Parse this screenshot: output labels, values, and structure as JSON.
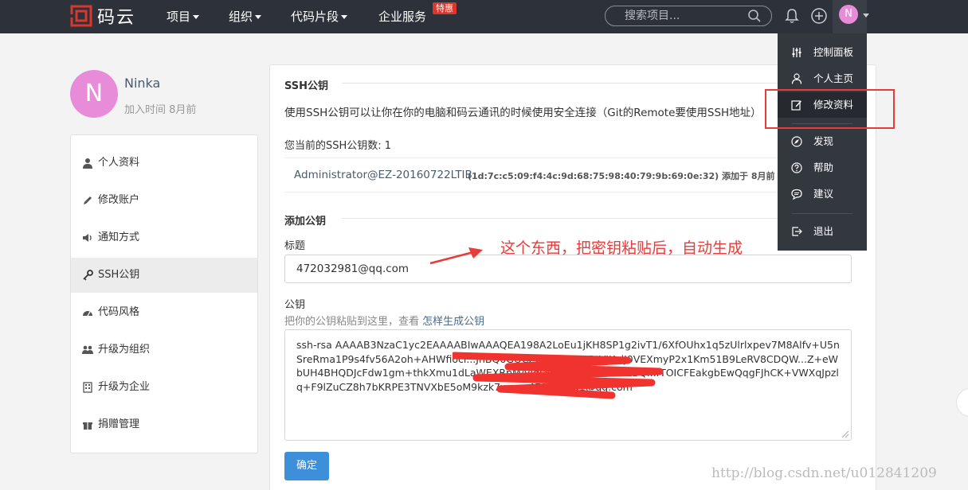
{
  "topbar": {
    "logo_text": "码云",
    "nav": [
      {
        "label": "项目",
        "has_caret": true
      },
      {
        "label": "组织",
        "has_caret": true
      },
      {
        "label": "代码片段",
        "has_caret": true
      },
      {
        "label": "企业服务",
        "has_caret": false
      }
    ],
    "badge": "特惠",
    "search_placeholder": "搜索项目...",
    "avatar_initial": "N"
  },
  "profile": {
    "avatar_initial": "N",
    "name": "Ninka",
    "joined": "加入时间 8月前"
  },
  "sidebar": {
    "items": [
      {
        "label": "个人资料",
        "icon": "user-icon"
      },
      {
        "label": "修改账户",
        "icon": "pencil-icon"
      },
      {
        "label": "通知方式",
        "icon": "speaker-icon"
      },
      {
        "label": "SSH公钥",
        "icon": "key-icon",
        "active": true
      },
      {
        "label": "代码风格",
        "icon": "dashboard-icon"
      },
      {
        "label": "升级为组织",
        "icon": "users-icon"
      },
      {
        "label": "升级为企业",
        "icon": "building-icon"
      },
      {
        "label": "捐赠管理",
        "icon": "gift-icon"
      }
    ]
  },
  "ssh": {
    "section_title": "SSH公钥",
    "description": "使用SSH公钥可以让你在你的电脑和码云通讯的时候使用安全连接（Git的Remote要使用SSH地址）",
    "count_text": "您当前的SSH公钥数: 1",
    "key": {
      "name": "Administrator@EZ-20160722LTIB",
      "fingerprint": "(1d:7c:c5:09:f4:4c:9d:68:75:98:40:79:9b:69:0e:32) 添加于 8月前"
    }
  },
  "add": {
    "section_title": "添加公钥",
    "title_label": "标题",
    "title_value": "472032981@qq.com",
    "key_label": "公钥",
    "hint": "把你的公钥粘贴到这里，查看",
    "hint_link": "怎样生成公钥",
    "key_value": "ssh-rsa AAAAB3NzaC1yc2EAAAABIwAAAQEA198A2LoEu1jKH8SP1g2ivT1/6XfOUhx1q5zUlrlxpev7M8Alfv+U5nSreRma1P9s4fv56A2oh+AHWfiocl...JnBQ6GOCZbwV+I2CRRtVJKulJ0VEXmyP2x1Km51B9LeRV8CDQW...Z+eWbUH4BHQDJcFdw1gm+thkXmu1dLaWEXRpM/yJqDQOyxH+Z9BNNZBQ...fTOICFEakgbEwQqgFJhCK+VWXqJpzlq+F9lZuCZ8h7bKRPE3TNVXbE5oM9kzk7w== 472032981@qq.com",
    "submit": "确定"
  },
  "dropdown": {
    "items": [
      {
        "label": "控制面板",
        "icon": "sliders-icon"
      },
      {
        "label": "个人主页",
        "icon": "person-icon"
      },
      {
        "label": "修改资料",
        "icon": "edit-icon",
        "highlighted": true
      },
      {
        "label": "发现",
        "icon": "compass-icon"
      },
      {
        "label": "帮助",
        "icon": "help-icon"
      },
      {
        "label": "建议",
        "icon": "comment-icon"
      },
      {
        "label": "退出",
        "icon": "logout-icon"
      }
    ]
  },
  "annotation": "这个东西，把密钥粘贴后，自动生成",
  "watermark": "http://blog.csdn.net/u012841209",
  "colors": {
    "topbar": "#2d323a",
    "accent": "#3c8fd8",
    "annotation_red": "#e83b3b",
    "avatar": "#e88cd9"
  }
}
